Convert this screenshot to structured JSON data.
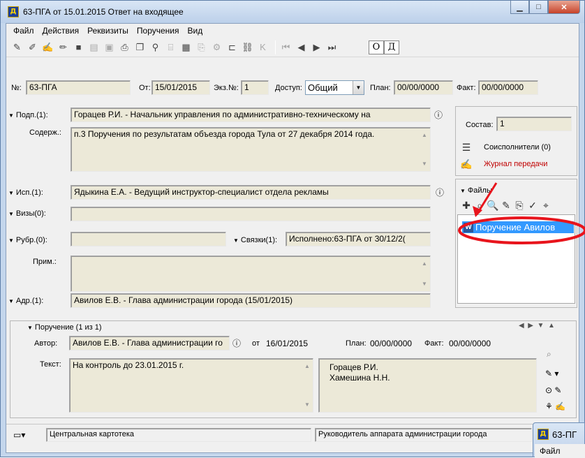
{
  "window": {
    "title": "63-ПГА от 15.01.2015 Ответ на входящее",
    "app_icon": "Д"
  },
  "menu": [
    "Файл",
    "Действия",
    "Реквизиты",
    "Поручения",
    "Вид"
  ],
  "toolbar_toggles": [
    "О",
    "Д"
  ],
  "header": {
    "num_label": "№:",
    "num_value": "63-ПГА",
    "from_label": "От:",
    "from_value": "15/01/2015",
    "copy_label": "Экз.№:",
    "copy_value": "1",
    "access_label": "Доступ:",
    "access_value": "Общий",
    "plan_label": "План:",
    "plan_value": "00/00/0000",
    "fact_label": "Факт:",
    "fact_value": "00/00/0000"
  },
  "form": {
    "signer_label": "Подп.(1):",
    "signer_value": "Горацев Р.И. - Начальник управления по административно-техническому на",
    "content_label": "Содерж.:",
    "content_value": "п.3 Поручения по результатам объезда города Тула от 27 декабря 2014 года.",
    "executor_label": "Исп.(1):",
    "executor_value": "Ядыкина Е.А. - Ведущий инструктор-специалист отдела рекламы",
    "visas_label": "Визы(0):",
    "rubric_label": "Рубр.(0):",
    "links_label": "Связки(1):",
    "links_value": "Исполнено:63-ПГА от 30/12/2(",
    "note_label": "Прим.:",
    "address_label": "Адр.(1):",
    "address_value": "Авилов Е.В. - Глава администрации города (15/01/2015)"
  },
  "side": {
    "composition_label": "Состав:",
    "composition_value": "1",
    "coexecutors": "Соисполнители (0)",
    "journal": "Журнал передачи",
    "files_label": "Файлы",
    "file_item": "Поручение Авилов"
  },
  "assignment": {
    "header": "Поручение (1 из 1)",
    "author_label": "Автор:",
    "author_value": "Авилов Е.В. - Глава администрации го",
    "from_label": "от",
    "from_value": "16/01/2015",
    "plan_label": "План:",
    "plan_value": "00/00/0000",
    "fact_label": "Факт:",
    "fact_value": "00/00/0000",
    "text_label": "Текст:",
    "text_value": "На контроль до 23.01.2015 г.",
    "executors": [
      "Горацев Р.И.",
      "Хамешина Н.Н."
    ]
  },
  "status": {
    "left": "Центральная картотека",
    "right": "Руководитель аппарата администрации города"
  },
  "second_window": {
    "title": "63-ПГ",
    "menu": "Файл"
  },
  "colors": {
    "annotation_red": "#e8141c",
    "selection_blue": "#3399ff",
    "journal_red": "#c00000"
  }
}
